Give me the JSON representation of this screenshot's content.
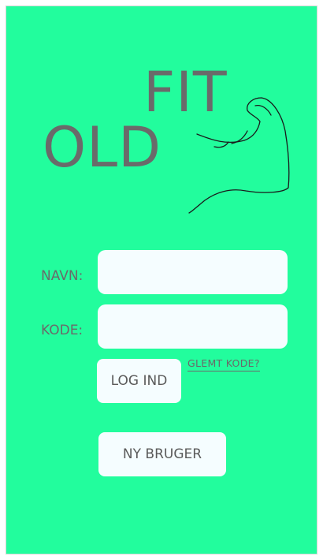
{
  "logo": {
    "word_top": "FIT",
    "word_bottom": "OLD",
    "icon": "flexed-arm-icon"
  },
  "login_form": {
    "name_label": "NAVN:",
    "name_value": "",
    "code_label": "KODE:",
    "code_value": "",
    "login_button": "LOG IND",
    "forgot_link": "GLEMT KODE?",
    "new_user_button": "NY BRUGER"
  },
  "colors": {
    "background": "#22fd9d",
    "text": "#6a6a6a",
    "field": "#f5fdff"
  }
}
